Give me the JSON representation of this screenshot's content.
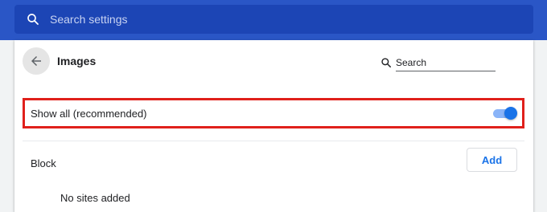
{
  "header": {
    "search_placeholder": "Search settings",
    "background_color": "#2a56c6"
  },
  "page": {
    "title": "Images",
    "search_label": "Search"
  },
  "show_all": {
    "label": "Show all (recommended)",
    "enabled": true,
    "highlight_color": "#e0201b"
  },
  "block": {
    "label": "Block",
    "add_label": "Add",
    "empty_text": "No sites added"
  },
  "icons": {
    "header_search": "search-icon",
    "back": "arrow-back-icon",
    "page_search": "search-icon"
  },
  "accent_color": "#1a73e8"
}
